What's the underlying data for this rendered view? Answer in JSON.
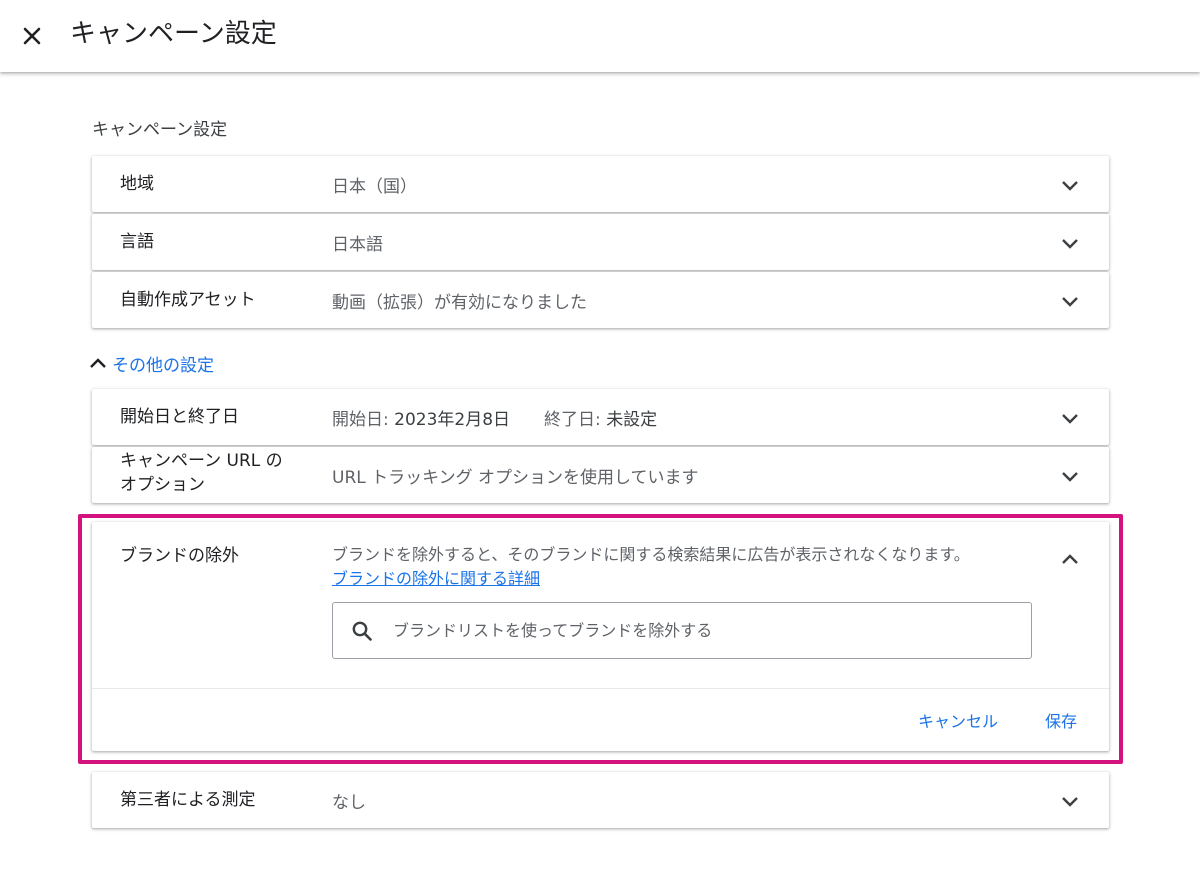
{
  "header": {
    "title": "キャンペーン設定",
    "close_icon": "close-icon"
  },
  "section": {
    "title": "キャンペーン設定"
  },
  "rows": {
    "location": {
      "label": "地域",
      "value": "日本（国）"
    },
    "language": {
      "label": "言語",
      "value": "日本語"
    },
    "auto_assets": {
      "label": "自動作成アセット",
      "value": "動画（拡張）が有効になりました"
    }
  },
  "more_settings": {
    "label": "その他の設定",
    "icon": "chevron-up-icon"
  },
  "dates": {
    "label": "開始日と終了日",
    "start_label": "開始日:",
    "start_value": "2023年2月8日",
    "end_label": "終了日:",
    "end_value": "未設定"
  },
  "url_options": {
    "label_line1": "キャンペーン URL の",
    "label_line2": "オプション",
    "value": "URL トラッキング オプションを使用しています"
  },
  "brand_exclusion": {
    "label": "ブランドの除外",
    "description": "ブランドを除外すると、そのブランドに関する検索結果に広告が表示されなくなります。",
    "link": "ブランドの除外に関する詳細",
    "search_placeholder": "ブランドリストを使ってブランドを除外する",
    "search_value": "",
    "cancel_label": "キャンセル",
    "save_label": "保存"
  },
  "third_party": {
    "label": "第三者による測定",
    "value": "なし"
  },
  "colors": {
    "accent": "#1a73e8",
    "highlight_border": "#d4127d",
    "text_primary": "#202124",
    "text_secondary": "#5f6368"
  }
}
